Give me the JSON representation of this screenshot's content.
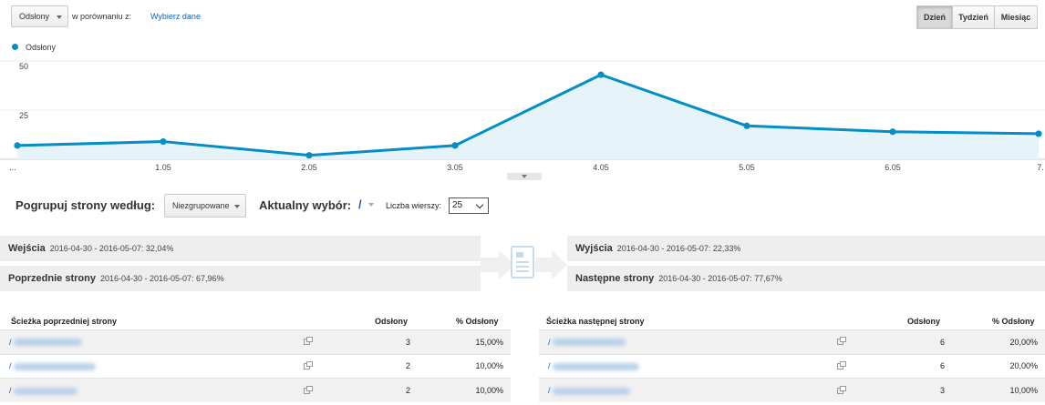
{
  "toolbar": {
    "metric_select": "Odsłony",
    "compare_label": "w porównaniu z:",
    "compare_link": "Wybierz dane",
    "period_buttons": [
      "Dzień",
      "Tydzień",
      "Miesiąc"
    ],
    "active_period": "Dzień"
  },
  "legend": {
    "series_name": "Odsłony",
    "color": "#058dc7"
  },
  "chart_data": {
    "type": "area",
    "x": [
      "...",
      "1.05",
      "2.05",
      "3.05",
      "4.05",
      "5.05",
      "6.05",
      "7."
    ],
    "series": [
      {
        "name": "Odsłony",
        "values": [
          7,
          9,
          2,
          7,
          43,
          17,
          14,
          13
        ]
      }
    ],
    "y_ticks": [
      "50",
      "25"
    ],
    "ylim": [
      0,
      50
    ],
    "grid": true,
    "color": "#058dc7"
  },
  "grouping": {
    "label": "Pogrupuj strony według:",
    "select_value": "Niezgrupowane",
    "current_label": "Aktualny wybór:",
    "current_value": "/",
    "rows_label": "Liczba wierszy:",
    "rows_value": "25"
  },
  "summary": {
    "entrances": {
      "label": "Wejścia",
      "value": "2016-04-30 - 2016-05-07: 32,04%"
    },
    "previous": {
      "label": "Poprzednie strony",
      "value": "2016-04-30 - 2016-05-07: 67,96%"
    },
    "exits": {
      "label": "Wyjścia",
      "value": "2016-04-30 - 2016-05-07: 22,33%"
    },
    "next": {
      "label": "Następne strony",
      "value": "2016-04-30 - 2016-05-07: 77,67%"
    }
  },
  "prev_table": {
    "headers": [
      "Ścieżka poprzedniej strony",
      "Odsłony",
      "% Odsłony"
    ],
    "rows": [
      {
        "path": "/",
        "views": "3",
        "pct": "15,00%"
      },
      {
        "path": "/",
        "views": "2",
        "pct": "10,00%"
      },
      {
        "path": "/",
        "views": "2",
        "pct": "10,00%"
      }
    ]
  },
  "next_table": {
    "headers": [
      "Ścieżka następnej strony",
      "Odsłony",
      "% Odsłony"
    ],
    "rows": [
      {
        "path": "/",
        "views": "6",
        "pct": "20,00%"
      },
      {
        "path": "/",
        "views": "6",
        "pct": "20,00%"
      },
      {
        "path": "/",
        "views": "3",
        "pct": "10,00%"
      }
    ]
  }
}
